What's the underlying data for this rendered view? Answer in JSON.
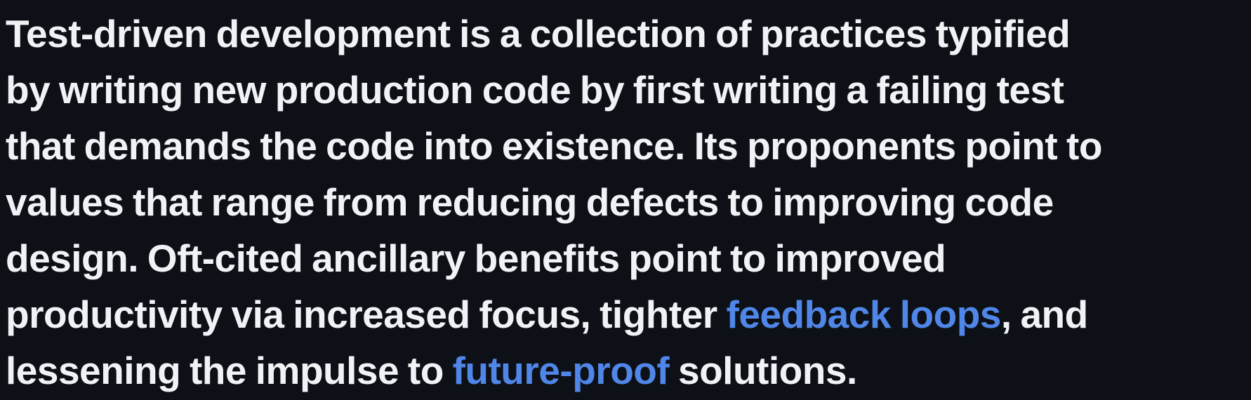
{
  "paragraph": {
    "line1": "Test-driven development is a collection of practices typified",
    "line2": "by writing new production code by first writing a failing test",
    "line3": "that demands the code into existence. Its proponents point to",
    "line4": "values that range from reducing defects to improving code",
    "line5": "design. Oft-cited ancillary benefits point to improved",
    "line6_before": "productivity via increased focus, tighter ",
    "link_feedback": "feedback loops",
    "line6_after": ", and",
    "line7_before": "lessening the impulse to ",
    "link_future": "future-proof",
    "line7_after": " solutions."
  },
  "colors": {
    "background": "#0d1117",
    "text": "#f0f3f6",
    "link": "#4f86e8"
  }
}
